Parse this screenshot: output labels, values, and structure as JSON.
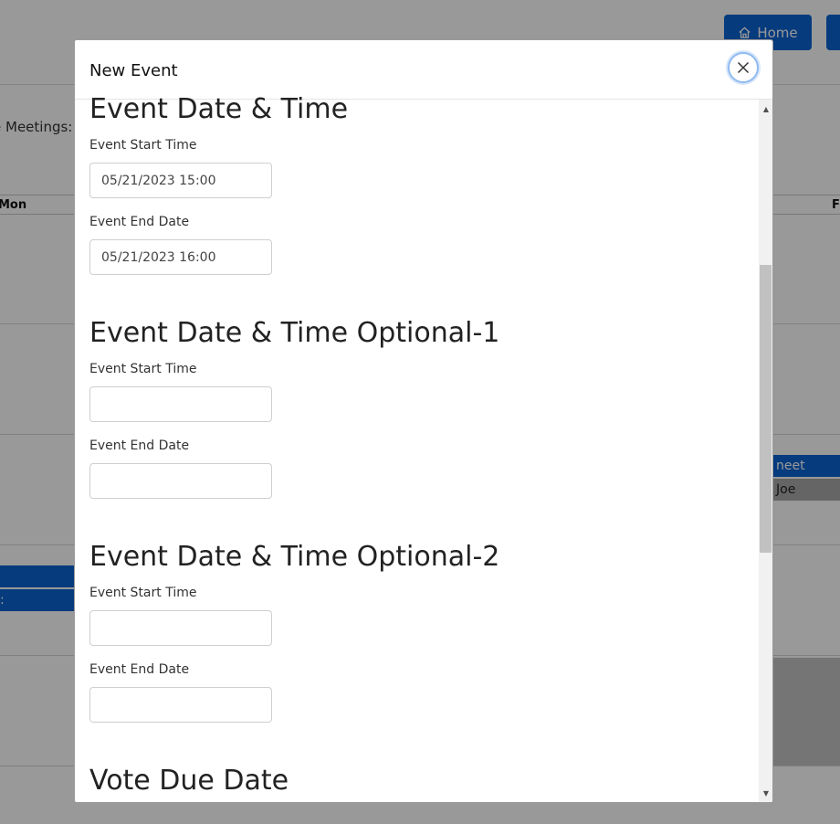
{
  "background": {
    "home_button_label": "Home",
    "meetings_label": "e Meetings:",
    "day_mon": "Mon",
    "day_fri": "F",
    "events": [
      {
        "label": "neet"
      },
      {
        "label": "Joe"
      },
      {
        "label": ""
      },
      {
        "label": ":"
      }
    ],
    "colors": {
      "accent": "#0a63d1",
      "overlay": "rgba(0,0,0,0.40)"
    }
  },
  "modal": {
    "title": "New Event",
    "close_icon": "close-icon",
    "sections": [
      {
        "title": "Event Date & Time",
        "start_label": "Event Start Time",
        "start_value": "05/21/2023 15:00",
        "end_label": "Event End Date",
        "end_value": "05/21/2023 16:00"
      },
      {
        "title": "Event Date & Time Optional-1",
        "start_label": "Event Start Time",
        "start_value": "",
        "end_label": "Event End Date",
        "end_value": ""
      },
      {
        "title": "Event Date & Time Optional-2",
        "start_label": "Event Start Time",
        "start_value": "",
        "end_label": "Event End Date",
        "end_value": ""
      },
      {
        "title": "Vote Due Date"
      }
    ]
  }
}
